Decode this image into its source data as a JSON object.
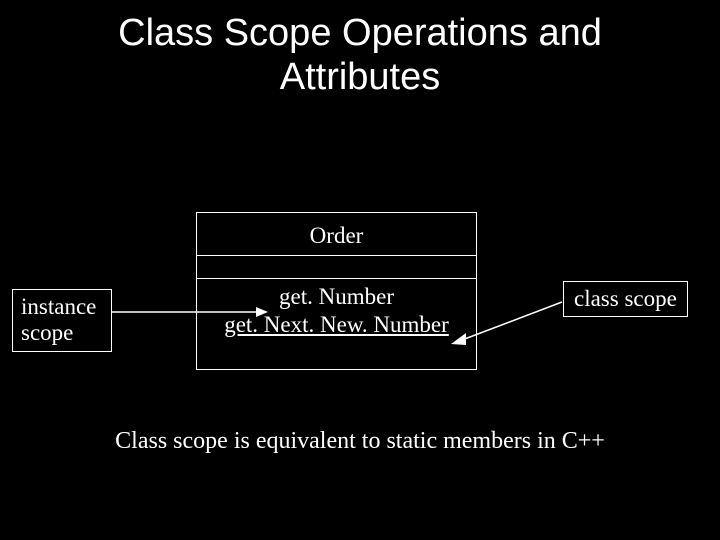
{
  "title": {
    "line1": "Class Scope Operations and",
    "line2": "Attributes"
  },
  "uml": {
    "className": "Order",
    "op1": "get. Number",
    "op2": "get. Next. New. Number"
  },
  "labels": {
    "instanceScope": "instance scope",
    "classScope": "class scope"
  },
  "footnote": "Class scope is equivalent to static members in C++"
}
